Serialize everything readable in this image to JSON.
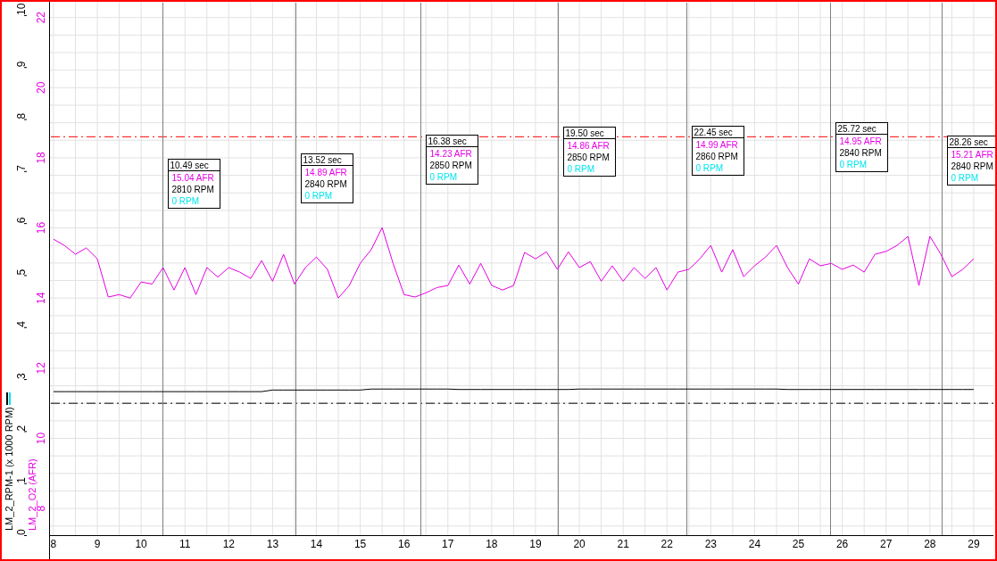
{
  "chart_data": {
    "type": "line",
    "ylabel": "LM_2_O2 (AFR)",
    "y2label": "LM_2_RPM-1 (x 1000 RPM)",
    "grid": true,
    "xlim": [
      7.92,
      29.45
    ],
    "ylim": [
      7.24,
      22.5
    ],
    "y2lim": [
      0,
      10.29
    ],
    "xticks": [
      8,
      9,
      10,
      11,
      12,
      13,
      14,
      15,
      16,
      17,
      18,
      19,
      20,
      21,
      22,
      23,
      24,
      25,
      26,
      27,
      28,
      29
    ],
    "yticks": [
      8,
      10,
      12,
      14,
      16,
      18,
      20,
      22
    ],
    "y2ticks": [
      0,
      1,
      2,
      3,
      4,
      5,
      6,
      7,
      8,
      9,
      10
    ],
    "x": [
      8,
      8.25,
      8.5,
      8.75,
      9,
      9.25,
      9.5,
      9.75,
      10,
      10.25,
      10.5,
      10.75,
      11,
      11.25,
      11.5,
      11.75,
      12,
      12.25,
      12.5,
      12.75,
      13,
      13.25,
      13.5,
      13.75,
      14,
      14.25,
      14.5,
      14.75,
      15,
      15.25,
      15.5,
      15.75,
      16,
      16.25,
      16.5,
      16.75,
      17,
      17.25,
      17.5,
      17.75,
      18,
      18.25,
      18.5,
      18.75,
      19,
      19.25,
      19.5,
      19.75,
      20,
      20.25,
      20.5,
      20.75,
      21,
      21.25,
      21.5,
      21.75,
      22,
      22.25,
      22.5,
      22.75,
      23,
      23.25,
      23.5,
      23.75,
      24,
      24.25,
      24.5,
      24.75,
      25,
      25.25,
      25.5,
      25.75,
      26,
      26.25,
      26.5,
      26.75,
      27,
      27.25,
      27.5,
      27.75,
      28,
      28.25,
      28.5,
      28.75,
      29
    ],
    "series": [
      {
        "axis": "y",
        "color": "#e600e6",
        "values": [
          15.68,
          15.5,
          15.25,
          15.43,
          15.12,
          14.03,
          14.1,
          14.0,
          14.46,
          14.4,
          14.87,
          14.23,
          14.87,
          14.1,
          14.87,
          14.6,
          14.87,
          14.74,
          14.56,
          15.07,
          14.48,
          15.25,
          14.4,
          14.87,
          15.17,
          14.82,
          14.0,
          14.36,
          14.99,
          15.38,
          16.01,
          14.99,
          14.1,
          14.03,
          14.15,
          14.3,
          14.36,
          14.94,
          14.4,
          14.99,
          14.36,
          14.23,
          14.36,
          15.3,
          15.12,
          15.32,
          14.82,
          15.32,
          14.87,
          15.04,
          14.48,
          14.92,
          14.48,
          14.87,
          14.56,
          14.87,
          14.23,
          14.74,
          14.82,
          15.12,
          15.5,
          14.74,
          15.38,
          14.61,
          14.92,
          15.17,
          15.5,
          14.87,
          14.4,
          15.12,
          14.92,
          14.99,
          14.82,
          14.94,
          14.74,
          15.25,
          15.33,
          15.5,
          15.76,
          14.36,
          15.76,
          15.25,
          14.61,
          14.82,
          15.12
        ]
      },
      {
        "axis": "y2",
        "color": "#000000",
        "values": [
          2.76,
          2.76,
          2.76,
          2.76,
          2.76,
          2.76,
          2.76,
          2.76,
          2.76,
          2.76,
          2.76,
          2.76,
          2.76,
          2.76,
          2.76,
          2.76,
          2.76,
          2.76,
          2.76,
          2.76,
          2.79,
          2.79,
          2.79,
          2.79,
          2.79,
          2.79,
          2.79,
          2.79,
          2.79,
          2.81,
          2.81,
          2.81,
          2.81,
          2.81,
          2.81,
          2.81,
          2.81,
          2.8,
          2.8,
          2.8,
          2.8,
          2.8,
          2.8,
          2.8,
          2.8,
          2.8,
          2.8,
          2.8,
          2.81,
          2.81,
          2.81,
          2.81,
          2.81,
          2.81,
          2.81,
          2.81,
          2.81,
          2.81,
          2.81,
          2.81,
          2.81,
          2.81,
          2.81,
          2.81,
          2.81,
          2.81,
          2.81,
          2.8,
          2.8,
          2.8,
          2.8,
          2.8,
          2.8,
          2.8,
          2.8,
          2.8,
          2.8,
          2.8,
          2.8,
          2.8,
          2.8,
          2.8,
          2.8,
          2.8,
          2.8
        ]
      }
    ],
    "ref_lines": [
      {
        "axis": "y",
        "value": 18.6,
        "color": "#ff0000"
      },
      {
        "axis": "y",
        "value": 11.0,
        "color": "#000000"
      },
      {
        "axis": "x",
        "value": 10.49,
        "color": "#808080"
      },
      {
        "axis": "x",
        "value": 13.52,
        "color": "#808080"
      },
      {
        "axis": "x",
        "value": 16.38,
        "color": "#808080"
      },
      {
        "axis": "x",
        "value": 19.5,
        "color": "#808080"
      },
      {
        "axis": "x",
        "value": 22.45,
        "color": "#808080"
      },
      {
        "axis": "x",
        "value": 25.72,
        "color": "#808080"
      },
      {
        "axis": "x",
        "value": 28.26,
        "color": "#808080"
      }
    ],
    "annotations": [
      "10.49 sec",
      "13.52 sec",
      "16.38 sec",
      "19.50 sec",
      "22.45 sec",
      "25.72 sec",
      "28.26 sec"
    ]
  },
  "legend_swatches": [
    {
      "color": "#000000"
    },
    {
      "color": "#00e5ee"
    }
  ],
  "cursor_readouts": [
    {
      "lines": [
        {
          "text": "15.04 AFR",
          "color": "#e600e6"
        },
        {
          "text": "2810 RPM",
          "color": "#000000"
        },
        {
          "text": "0 RPM",
          "color": "#00e5ee"
        }
      ]
    },
    {
      "lines": [
        {
          "text": "14.89 AFR",
          "color": "#e600e6"
        },
        {
          "text": "2840 RPM",
          "color": "#000000"
        },
        {
          "text": "0 RPM",
          "color": "#00e5ee"
        }
      ]
    },
    {
      "lines": [
        {
          "text": "14.23 AFR",
          "color": "#e600e6"
        },
        {
          "text": "2850 RPM",
          "color": "#000000"
        },
        {
          "text": "0 RPM",
          "color": "#00e5ee"
        }
      ]
    },
    {
      "lines": [
        {
          "text": "14.86 AFR",
          "color": "#e600e6"
        },
        {
          "text": "2850 RPM",
          "color": "#000000"
        },
        {
          "text": "0 RPM",
          "color": "#00e5ee"
        }
      ]
    },
    {
      "lines": [
        {
          "text": "14.99 AFR",
          "color": "#e600e6"
        },
        {
          "text": "2860 RPM",
          "color": "#000000"
        },
        {
          "text": "0 RPM",
          "color": "#00e5ee"
        }
      ]
    },
    {
      "lines": [
        {
          "text": "14.95 AFR",
          "color": "#e600e6"
        },
        {
          "text": "2840 RPM",
          "color": "#000000"
        },
        {
          "text": "0 RPM",
          "color": "#00e5ee"
        }
      ]
    },
    {
      "lines": [
        {
          "text": "15.21 AFR",
          "color": "#e600e6"
        },
        {
          "text": "2840 RPM",
          "color": "#000000"
        },
        {
          "text": "0 RPM",
          "color": "#00e5ee"
        }
      ]
    }
  ]
}
